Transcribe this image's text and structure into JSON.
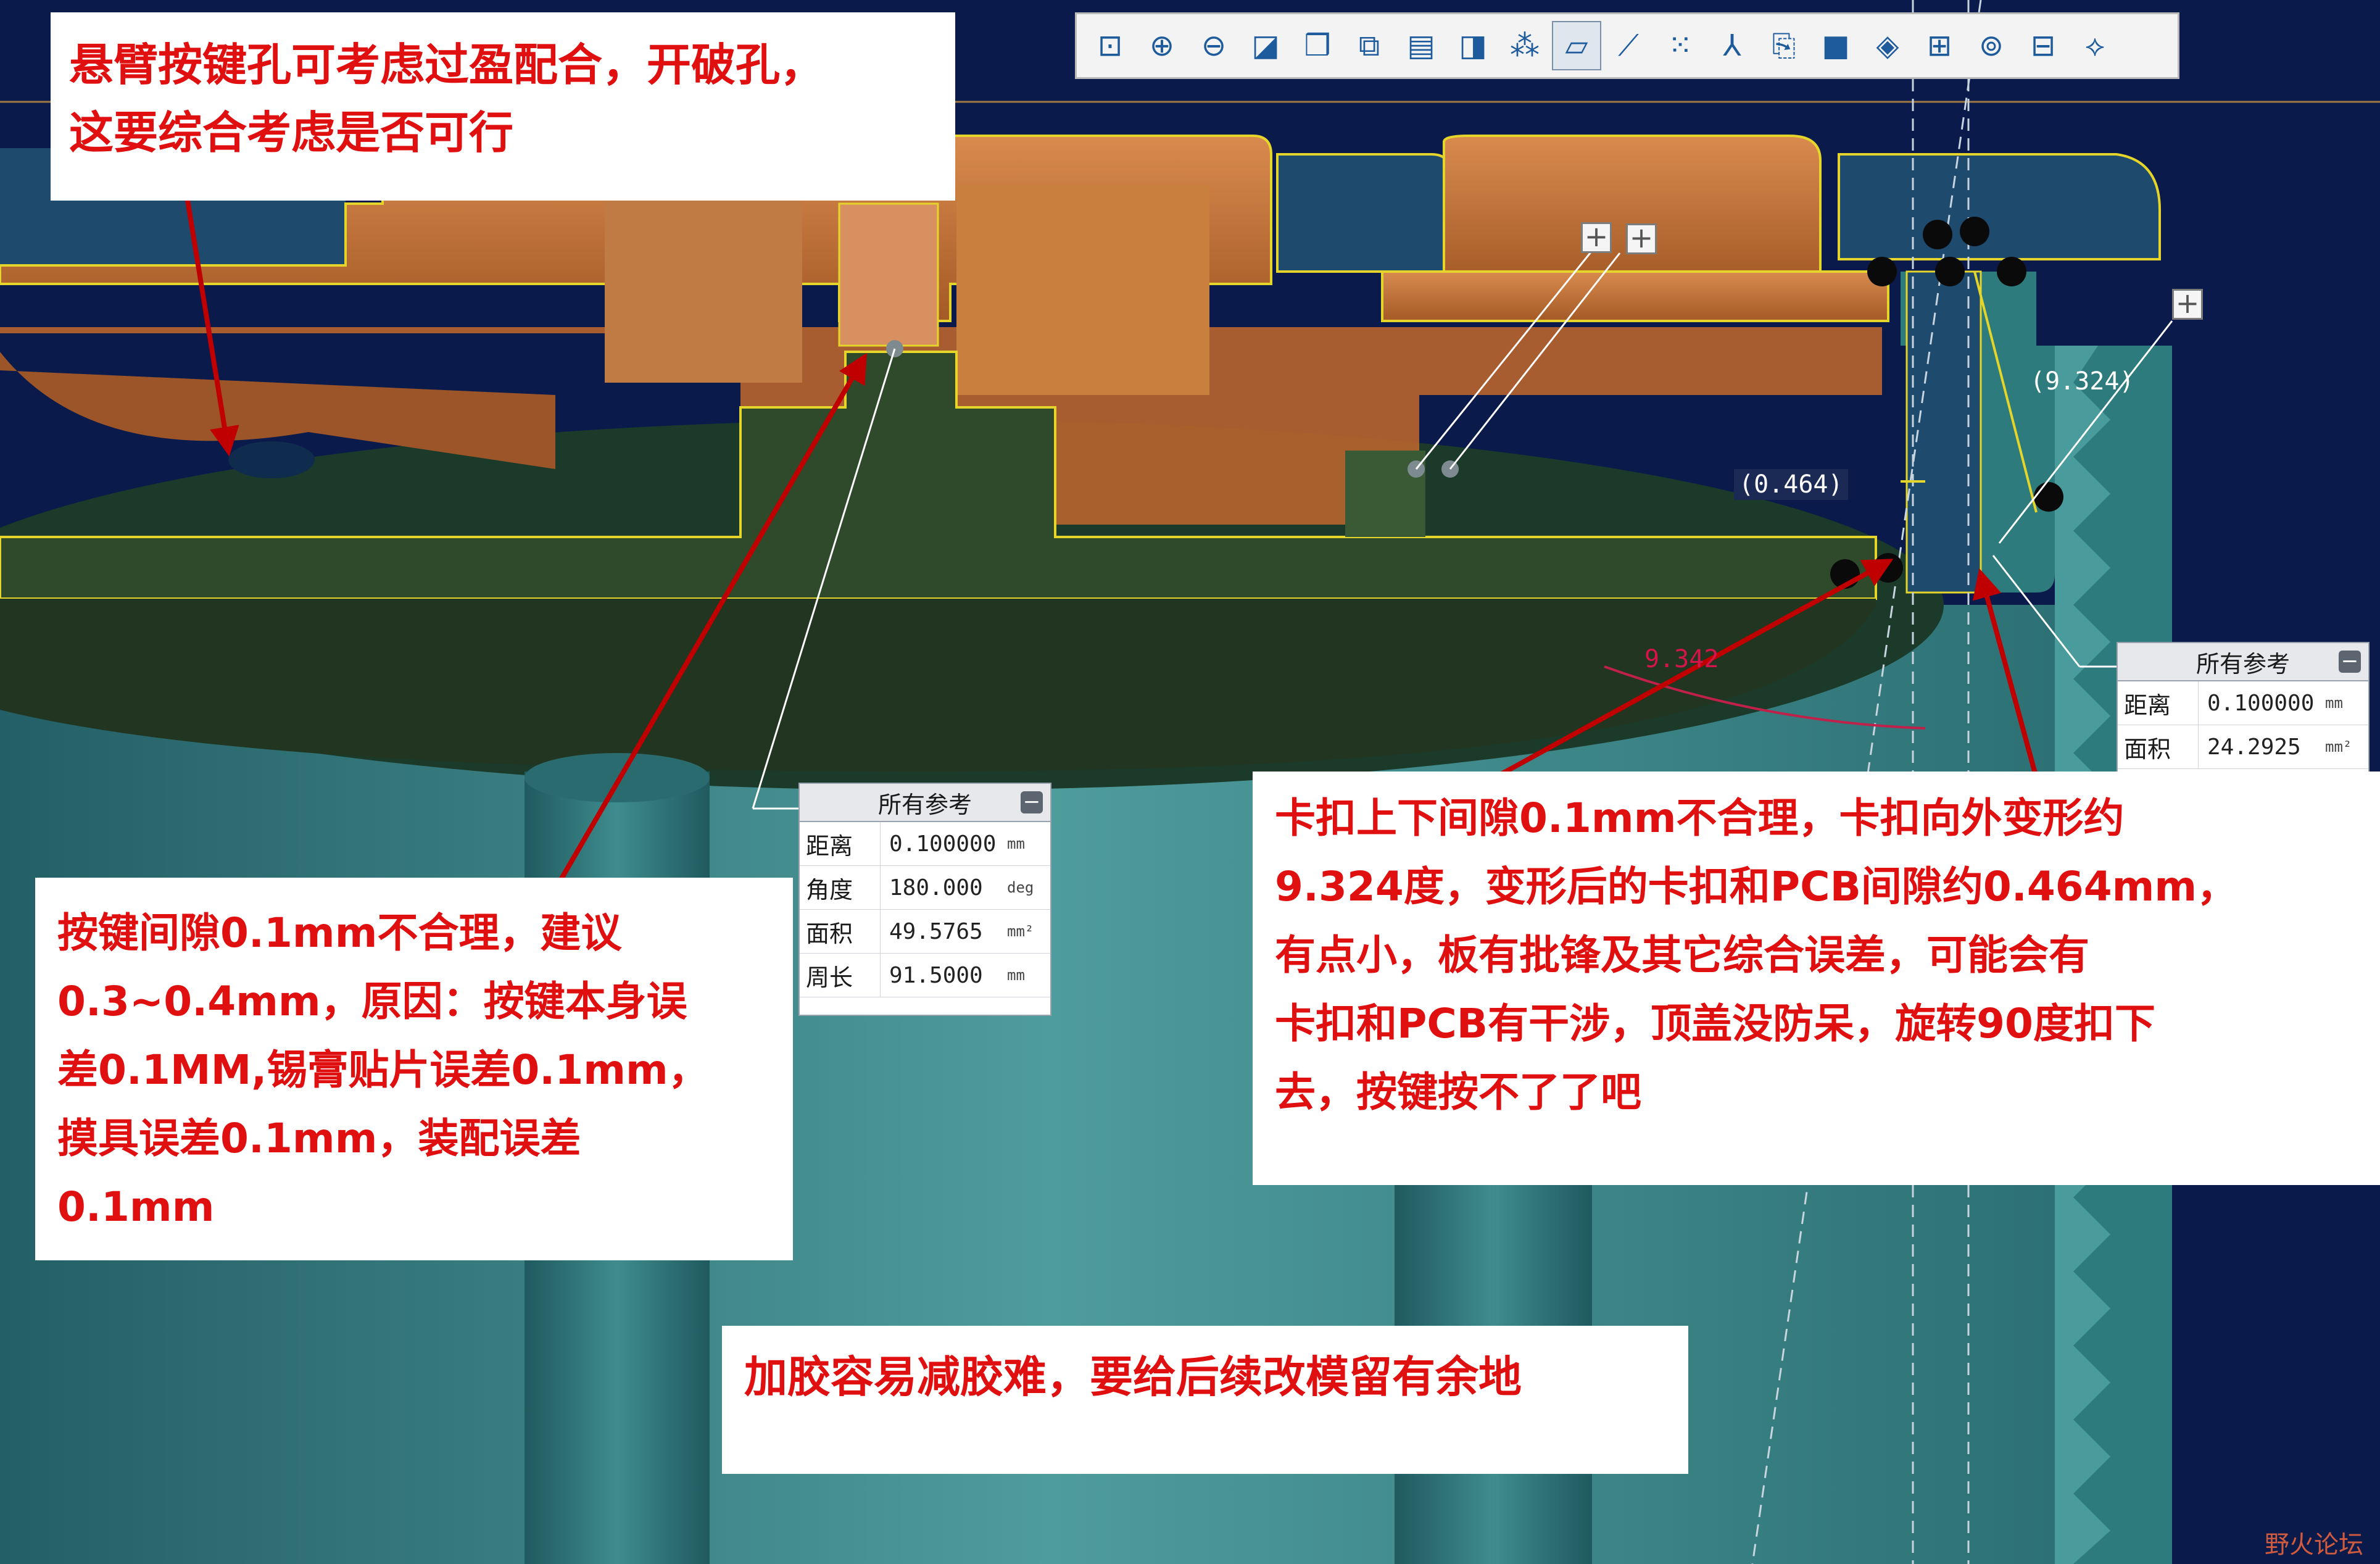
{
  "toolbar": {
    "buttons": [
      {
        "icon": "refit-zoom-icon",
        "glyph": "⊡"
      },
      {
        "icon": "zoom-in-icon",
        "glyph": "⊕"
      },
      {
        "icon": "zoom-out-icon",
        "glyph": "⊖"
      },
      {
        "icon": "repaint-icon",
        "glyph": "◪"
      },
      {
        "icon": "view-cube-icon",
        "glyph": "❒"
      },
      {
        "icon": "saved-views-icon",
        "glyph": "⧉"
      },
      {
        "icon": "view-manager-icon",
        "glyph": "▤"
      },
      {
        "icon": "perspective-icon",
        "glyph": "◨"
      },
      {
        "icon": "datum-display-icon",
        "glyph": "⁂"
      },
      {
        "icon": "plane-display-icon",
        "glyph": "▱"
      },
      {
        "icon": "axis-display-icon",
        "glyph": "⟋"
      },
      {
        "icon": "point-display-icon",
        "glyph": "⁙"
      },
      {
        "icon": "csys-display-icon",
        "glyph": "⅄"
      },
      {
        "icon": "annotation-display-icon",
        "glyph": "⎘"
      },
      {
        "icon": "shading-icon",
        "glyph": "■"
      },
      {
        "icon": "display-style-icon",
        "glyph": "◈"
      },
      {
        "icon": "section-icon",
        "glyph": "⊞"
      },
      {
        "icon": "orient-icon",
        "glyph": "⊚"
      },
      {
        "icon": "appearance-icon",
        "glyph": "⊟"
      },
      {
        "icon": "spin-center-icon",
        "glyph": "⟡"
      }
    ],
    "active_index": 9
  },
  "notes": {
    "cantilever": [
      "悬臂按键孔可考虑过盈配合，开破孔，",
      "这要综合考虑是否可行"
    ],
    "button_gap": [
      "按键间隙0.1mm不合理，建议",
      "0.3~0.4mm，原因：按键本身误",
      "差0.1MM,锡膏贴片误差0.1mm，",
      "摸具误差0.1mm，装配误差",
      "0.1mm"
    ],
    "snap_gap": [
      "卡扣上下间隙0.1mm不合理，卡扣向外变形约",
      "9.324度，变形后的卡扣和PCB间隙约0.464mm，",
      "有点小，板有批锋及其它综合误差，可能会有",
      "卡扣和PCB有干涉，顶盖没防呆，旋转90度扣下",
      "去，按键按不了了吧"
    ],
    "glue": [
      "加胶容易减胶难，要给后续改模留有余地"
    ]
  },
  "panel1": {
    "title": "所有参考",
    "rows": [
      {
        "label": "距离",
        "value": "0.100000",
        "unit": "mm"
      },
      {
        "label": "角度",
        "value": "180.000",
        "unit": "deg"
      },
      {
        "label": "面积",
        "value": "49.5765",
        "unit": "mm²"
      },
      {
        "label": "周长",
        "value": "91.5000",
        "unit": "mm"
      }
    ]
  },
  "panel2": {
    "title": "所有参考",
    "rows": [
      {
        "label": "距离",
        "value": "0.100000",
        "unit": "mm"
      },
      {
        "label": "面积",
        "value": "24.2925",
        "unit": "mm²"
      }
    ]
  },
  "dimensions": {
    "angle": "(9.324)",
    "gap": "(0.464)",
    "angle_red": "9.342"
  },
  "watermark": "野火论坛",
  "colors": {
    "background": "#0a1a4a",
    "copper": "#c8773d",
    "green": "#2e4a2a",
    "teal": "#2d7b7c",
    "note_text": "#e01010",
    "arrow": "#c00000"
  }
}
